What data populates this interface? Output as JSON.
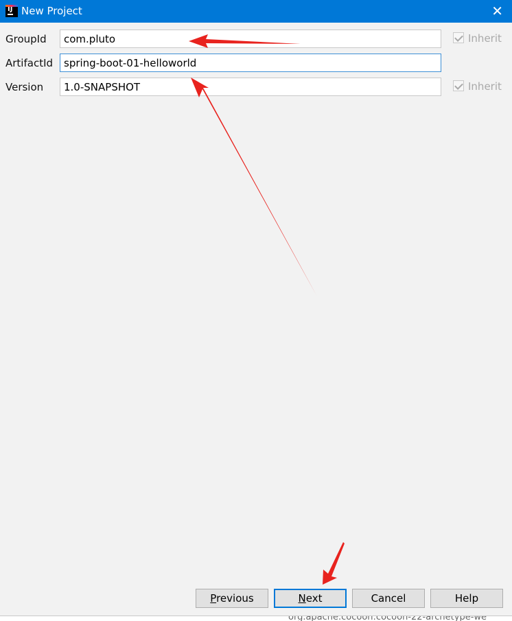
{
  "window": {
    "title": "New Project",
    "close_icon": "close-icon"
  },
  "form": {
    "group_id": {
      "label": "GroupId",
      "value": "com.pluto",
      "inherit_label": "Inherit"
    },
    "artifact_id": {
      "label": "ArtifactId",
      "value": "spring-boot-01-helloworld"
    },
    "version": {
      "label": "Version",
      "value": "1.0-SNAPSHOT",
      "inherit_label": "Inherit"
    }
  },
  "buttons": {
    "previous": {
      "mnemonic": "P",
      "rest": "revious"
    },
    "next": {
      "mnemonic": "N",
      "rest": "ext"
    },
    "cancel": "Cancel",
    "help": "Help"
  },
  "background_text": "org.apache.cocoon:cocoon-22-archetype-we",
  "colors": {
    "titlebar": "#0078d7",
    "annotation_arrow": "#e8231e"
  }
}
